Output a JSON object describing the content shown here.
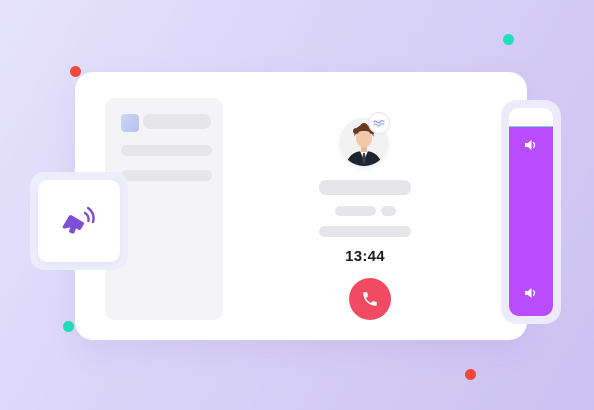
{
  "call": {
    "timer": "13:44",
    "end_call_icon": "phone-hangup-icon"
  },
  "speaker": {
    "icon": "speaker-icon",
    "accent": "#7d4fd6"
  },
  "volume": {
    "level_fraction": 0.91,
    "fill_color": "#bb4bff",
    "top_icon": "volume-icon",
    "bottom_icon": "volume-icon"
  },
  "colors": {
    "end_call": "#f04b63",
    "accent_red": "#f04a3a",
    "accent_teal": "#1fe0b8"
  }
}
